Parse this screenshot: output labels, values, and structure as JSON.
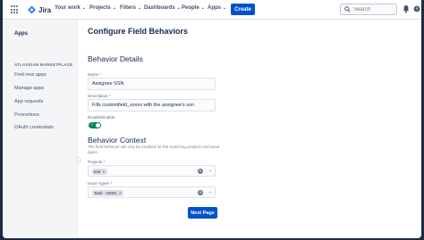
{
  "nav": {
    "product": "Jira",
    "items": [
      "Your work",
      "Projects",
      "Filters",
      "Dashboards",
      "People",
      "Apps"
    ],
    "create_label": "Create",
    "search_placeholder": "Search"
  },
  "sidebar": {
    "title": "Apps",
    "section": "ATLASSIAN MARKETPLACE",
    "items": [
      "Find new apps",
      "Manage apps",
      "App requests",
      "Promotions",
      "OAuth credentials"
    ]
  },
  "main": {
    "title": "Configure Field Behaviors",
    "details_heading": "Behavior Details",
    "name_label": "Name",
    "name_value": "Assignee SSN",
    "description_label": "Description",
    "description_value": "Fills customfield_xxxxx with the assignee's ssn",
    "toggle_label": "Disable/Enable",
    "context_heading": "Behavior Context",
    "context_help": "The field behavior will only be enabled for the matching projects and issue types.",
    "projects_label": "Projects",
    "projects_tag": "test",
    "issue_types_label": "Issue Types",
    "issue_types_tag": "Task - 10001",
    "next_label": "Next Page"
  },
  "colors": {
    "brand": "#0052cc",
    "toggle_on": "#00875a",
    "required": "#de350b"
  }
}
